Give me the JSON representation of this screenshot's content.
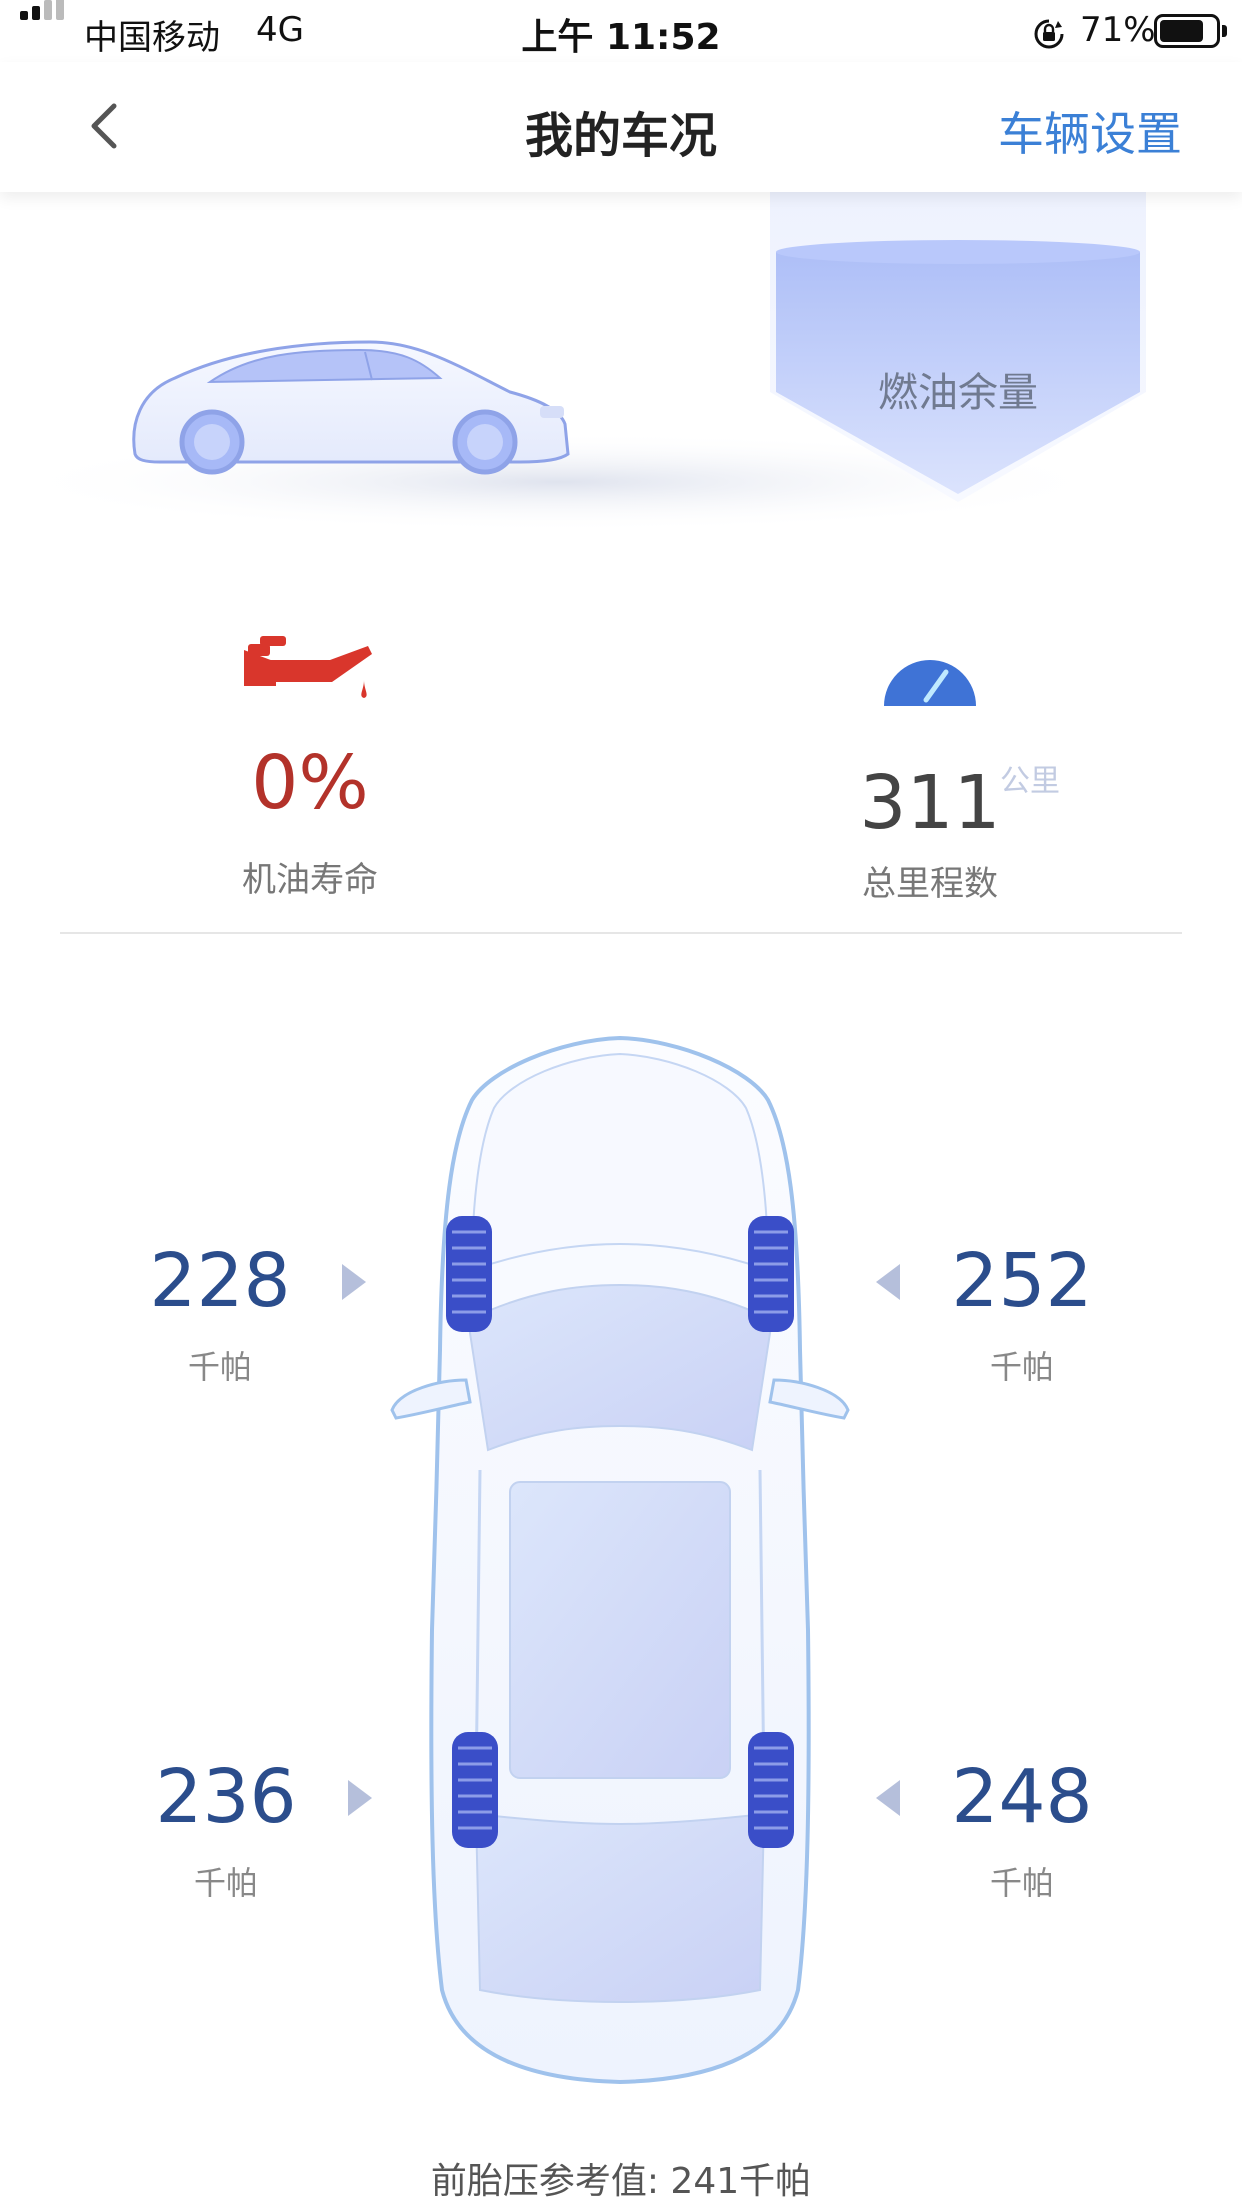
{
  "status_bar": {
    "carrier": "中国移动",
    "network": "4G",
    "time": "上午 11:52",
    "battery_percent": "71%",
    "battery_level": 0.71
  },
  "nav": {
    "title": "我的车况",
    "right_action": "车辆设置",
    "back_icon": "chevron-left-icon"
  },
  "hero": {
    "fuel_label": "燃油余量"
  },
  "stats": {
    "oil": {
      "icon": "oil-can-icon",
      "value": "0%",
      "label": "机油寿命"
    },
    "odometer": {
      "icon": "speedometer-icon",
      "value": "311",
      "unit": "公里",
      "label": "总里程数"
    }
  },
  "tires": {
    "front_left": {
      "value": "228",
      "unit": "千帕"
    },
    "front_right": {
      "value": "252",
      "unit": "千帕"
    },
    "rear_left": {
      "value": "236",
      "unit": "千帕"
    },
    "rear_right": {
      "value": "248",
      "unit": "千帕"
    }
  },
  "reference": "前胎压参考值: 241千帕",
  "colors": {
    "accent": "#3b80d6",
    "oil_red": "#b3322a",
    "tire_value": "#2b4d8c",
    "gauge_blue": "#3f73d6"
  }
}
